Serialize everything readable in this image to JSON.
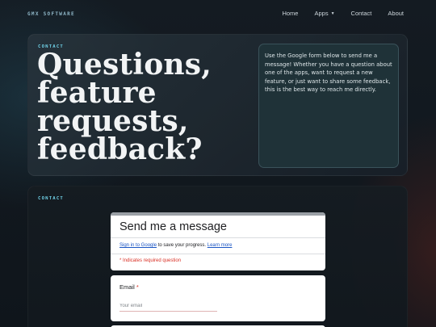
{
  "nav": {
    "brand": "GMX SOFTWARE",
    "links": [
      {
        "label": "Home"
      },
      {
        "label": "Apps"
      },
      {
        "label": "Contact"
      },
      {
        "label": "About"
      }
    ]
  },
  "hero": {
    "eyebrow": "CONTACT",
    "title": "Questions, feature requests, feedback?",
    "intro": "Use the Google form below to send me a message! Whether you have a question about one of the apps, want to request a new feature, or just want to share some feedback, this is the best way to reach me directly."
  },
  "contact": {
    "eyebrow": "CONTACT"
  },
  "form": {
    "title": "Send me a message",
    "signin_link": "Sign in to Google",
    "signin_text": " to save your progress. ",
    "learn_more": "Learn more",
    "required_note": "* Indicates required question",
    "email_label": "Email",
    "required_star": "*",
    "email_placeholder": "Your email"
  },
  "colors": {
    "accent": "#6fd0e6",
    "required": "#d93025",
    "link": "#1a55c4"
  }
}
